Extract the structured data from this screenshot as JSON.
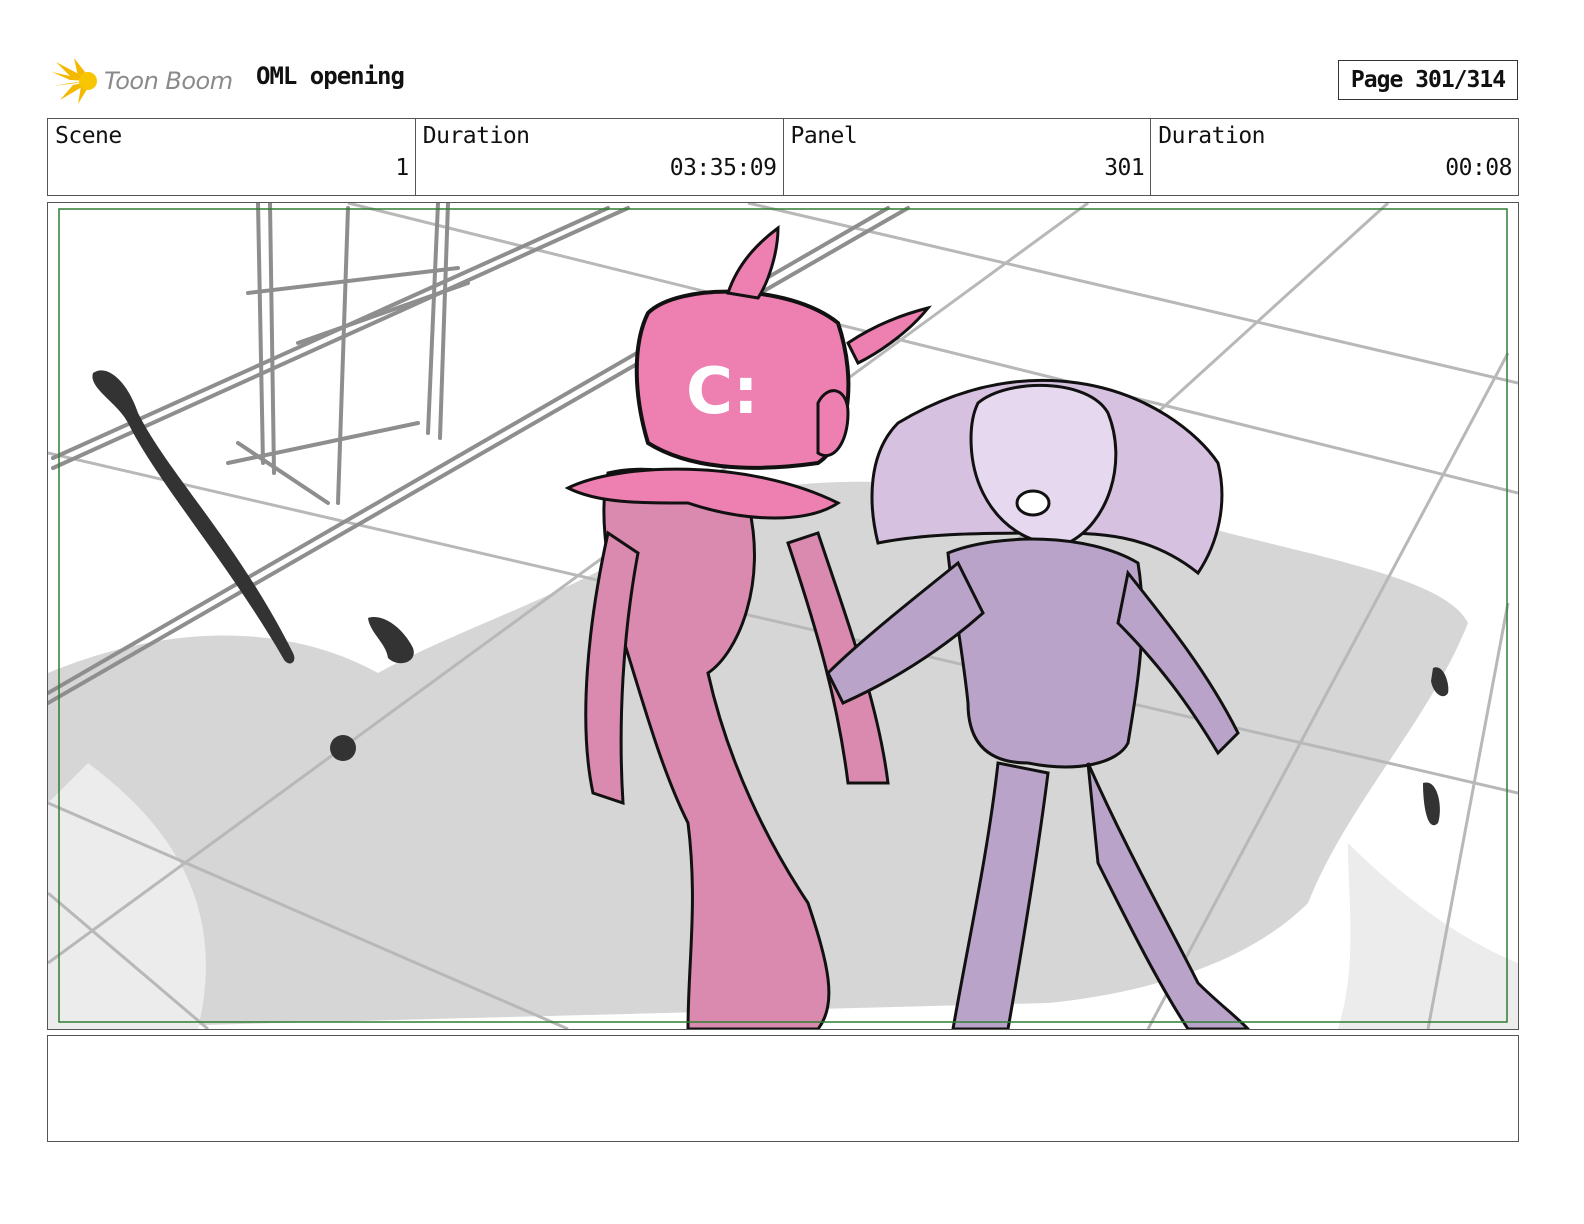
{
  "header": {
    "logo_text": "Toon Boom",
    "title": "OML opening",
    "page": "Page 301/314"
  },
  "info": {
    "scene_label": "Scene",
    "scene_value": "1",
    "duration_label": "Duration",
    "duration_value": "03:35:09",
    "panel_label": "Panel",
    "panel_value": "301",
    "panel_duration_label": "Duration",
    "panel_duration_value": "00:08"
  },
  "panel": {
    "robot_face_glyph": "C:",
    "colors": {
      "robot_pink": "#ee7fb1",
      "robot_body": "#d98aae",
      "girl_lilac": "#b9a3c9",
      "hair_lilac": "#d7c1e1",
      "shadow_gray": "#d6d6d6",
      "safe_frame": "#2e7d32"
    }
  },
  "notes": {
    "text": ""
  }
}
